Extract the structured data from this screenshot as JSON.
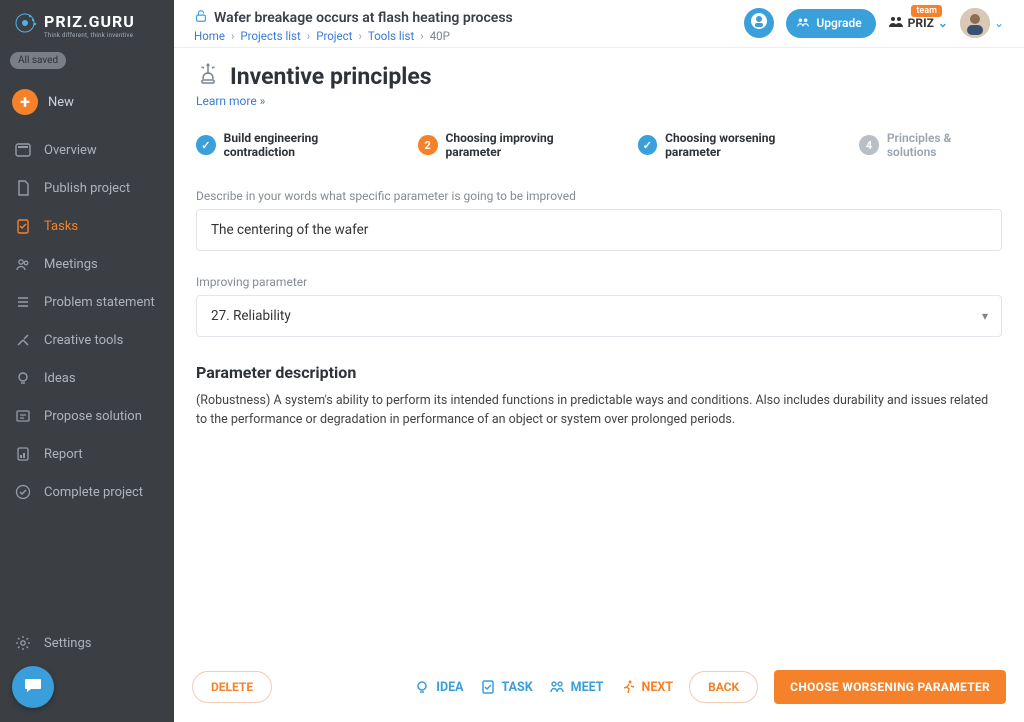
{
  "brand": {
    "name": "PRIZ.GURU",
    "tagline": "Think different, think inventive"
  },
  "saved_badge": "All saved",
  "sidebar": {
    "new_label": "New",
    "items": [
      {
        "label": "Overview"
      },
      {
        "label": "Publish project"
      },
      {
        "label": "Tasks"
      },
      {
        "label": "Meetings"
      },
      {
        "label": "Problem statement"
      },
      {
        "label": "Creative tools"
      },
      {
        "label": "Ideas"
      },
      {
        "label": "Propose solution"
      },
      {
        "label": "Report"
      },
      {
        "label": "Complete project"
      }
    ],
    "settings_label": "Settings"
  },
  "top": {
    "title": "Wafer breakage occurs at flash heating process",
    "upgrade": "Upgrade",
    "team_label": "PRIZ",
    "team_badge": "team",
    "breadcrumbs": {
      "home": "Home",
      "projects_list": "Projects list",
      "project": "Project",
      "tools_list": "Tools list",
      "current": "40P"
    }
  },
  "page": {
    "title": "Inventive principles",
    "learn_more": "Learn more »"
  },
  "stepper": {
    "s1": "Build engineering contradiction",
    "s2": "Choosing improving parameter",
    "s3": "Choosing worsening parameter",
    "s4": "Principles & solutions",
    "n2": "2",
    "n4": "4"
  },
  "form": {
    "describe_label": "Describe in your words what specific parameter is going to be improved",
    "describe_value": "The centering of the wafer",
    "improving_label": "Improving parameter",
    "improving_value": "27. Reliability",
    "param_desc_title": "Parameter description",
    "param_desc_body": "(Robustness) A system's ability to perform its intended functions in predictable ways and conditions. Also includes durability and issues related to the performance or degradation in performance of an object or system over prolonged periods."
  },
  "footer": {
    "delete": "DELETE",
    "idea": "IDEA",
    "task": "TASK",
    "meet": "MEET",
    "next": "NEXT",
    "back": "BACK",
    "primary": "CHOOSE WORSENING PARAMETER"
  }
}
